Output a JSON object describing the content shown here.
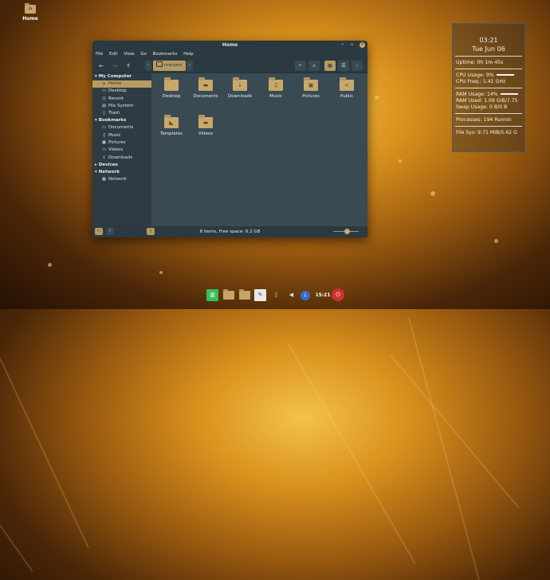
{
  "desktop": {
    "home_icon_label": "Home"
  },
  "window": {
    "title": "Home",
    "menu": [
      "File",
      "Edit",
      "View",
      "Go",
      "Bookmarks",
      "Help"
    ],
    "path_label": "manjaro",
    "sidebar": {
      "sections": [
        {
          "header": "My Computer",
          "items": [
            {
              "label": "Home",
              "icon": "home-icon",
              "glyph": "⌂",
              "selected": true
            },
            {
              "label": "Desktop",
              "icon": "desktop-icon",
              "glyph": "▭"
            },
            {
              "label": "Recent",
              "icon": "clock-icon",
              "glyph": "◷"
            },
            {
              "label": "File System",
              "icon": "drive-icon",
              "glyph": "▤"
            },
            {
              "label": "Trash",
              "icon": "trash-icon",
              "glyph": "▯"
            }
          ]
        },
        {
          "header": "Bookmarks",
          "items": [
            {
              "label": "Documents",
              "icon": "documents-icon",
              "glyph": "▭"
            },
            {
              "label": "Music",
              "icon": "music-icon",
              "glyph": "♫"
            },
            {
              "label": "Pictures",
              "icon": "pictures-icon",
              "glyph": "▣"
            },
            {
              "label": "Videos",
              "icon": "videos-icon",
              "glyph": "▭"
            },
            {
              "label": "Downloads",
              "icon": "download-icon",
              "glyph": "↓"
            }
          ]
        },
        {
          "header": "Devices",
          "items": []
        },
        {
          "header": "Network",
          "items": [
            {
              "label": "Network",
              "icon": "network-icon",
              "glyph": "▦"
            }
          ]
        }
      ]
    },
    "files": [
      {
        "name": "Desktop",
        "icon": "folder-icon",
        "glyph": ""
      },
      {
        "name": "Documents",
        "icon": "folder-documents-icon",
        "glyph": "▬"
      },
      {
        "name": "Downloads",
        "icon": "folder-download-icon",
        "glyph": "↓"
      },
      {
        "name": "Music",
        "icon": "folder-music-icon",
        "glyph": "♫"
      },
      {
        "name": "Pictures",
        "icon": "folder-pictures-icon",
        "glyph": "▣"
      },
      {
        "name": "Public",
        "icon": "folder-share-icon",
        "glyph": "<"
      },
      {
        "name": "Templates",
        "icon": "folder-templates-icon",
        "glyph": "◣"
      },
      {
        "name": "Videos",
        "icon": "folder-videos-icon",
        "glyph": "▬"
      }
    ],
    "status_text": "8 items, Free space: 6.2 GB",
    "zoom_level": 0.55
  },
  "conky": {
    "time": "03:21",
    "date": "Tue Jun 06",
    "uptime": "Uptime: 0h 1m 45s",
    "cpu_usage": "CPU Usage: 9%",
    "cpu_freq": "CPU Freq.: 1.41 GHz",
    "ram_usage": "RAM Usage: 14%",
    "ram_used": "RAM Used: 1.09 GiB/7.75",
    "swap_usage": "Swap Usage: 0 B/0 B",
    "processes": "Processes: 194   Runnin",
    "file_sys": "File Sys: 9.71 MiB/5.62 G"
  },
  "dock": {
    "clock": "15:21"
  }
}
